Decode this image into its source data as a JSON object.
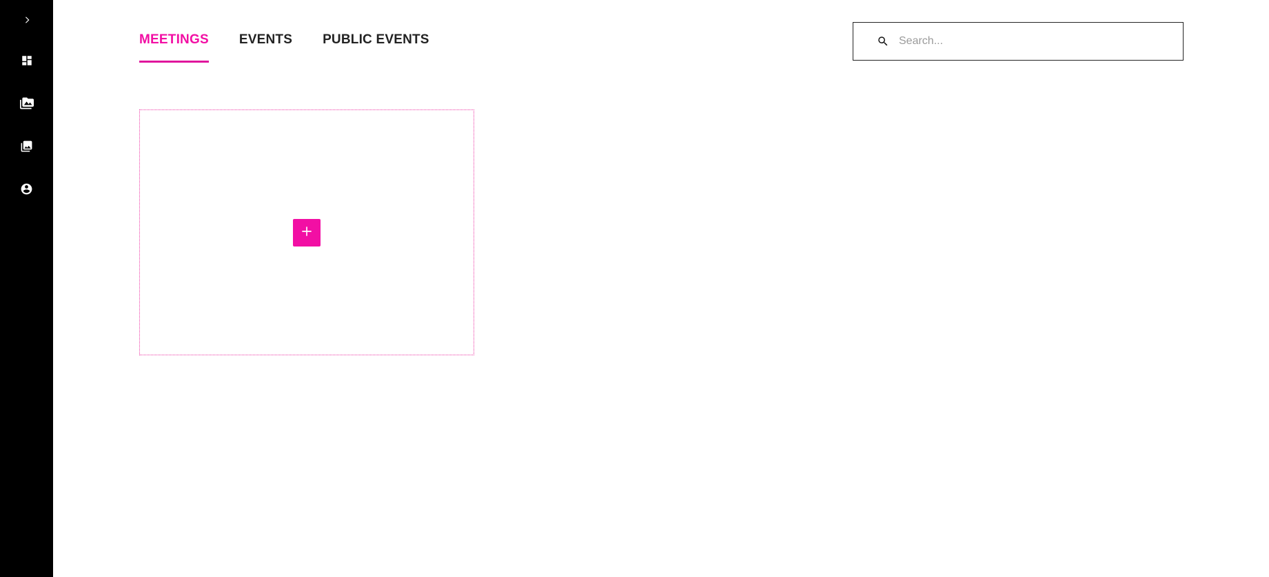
{
  "sidebar": {
    "items": [
      {
        "name": "expand",
        "icon": "chevron-right-icon"
      },
      {
        "name": "dashboard",
        "icon": "dashboard-icon"
      },
      {
        "name": "folder-images",
        "icon": "photo-library-icon"
      },
      {
        "name": "gallery",
        "icon": "collections-icon"
      },
      {
        "name": "account",
        "icon": "account-circle-icon"
      }
    ]
  },
  "tabs": [
    {
      "label": "MEETINGS",
      "active": true
    },
    {
      "label": "EVENTS",
      "active": false
    },
    {
      "label": "PUBLIC EVENTS",
      "active": false
    }
  ],
  "search": {
    "placeholder": "Search...",
    "value": "",
    "icon": "search-icon"
  },
  "add_card": {
    "icon": "plus-icon"
  },
  "colors": {
    "accent": "#f20fa4",
    "sidebar_bg": "#000000",
    "text": "#222222",
    "background": "#ffffff"
  }
}
